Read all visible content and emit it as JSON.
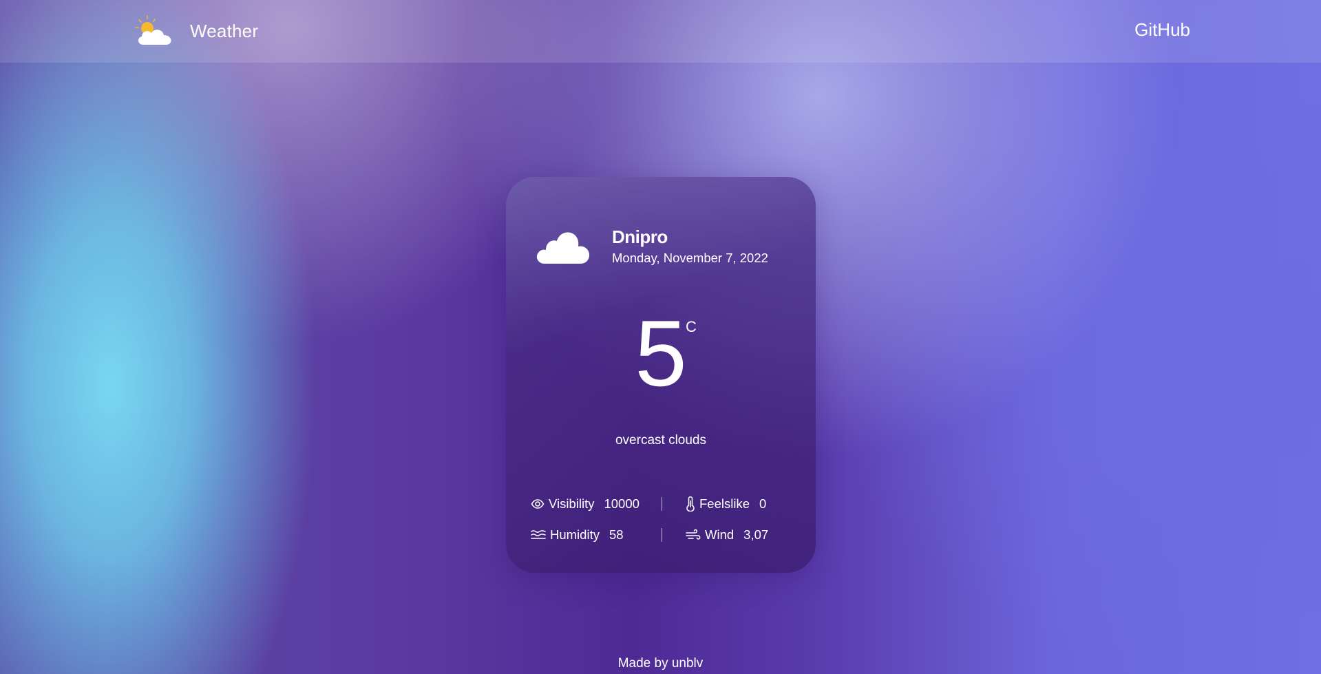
{
  "navbar": {
    "brand_text": "Weather",
    "brand_icon": "partly-cloudy-icon",
    "github_label": "GitHub"
  },
  "weather_card": {
    "city": "Dnipro",
    "date": "Monday, November 7, 2022",
    "temperature": "5",
    "unit": "C",
    "description": "overcast clouds",
    "condition_icon": "cloud-icon",
    "stats": {
      "visibility": {
        "label": "Visibility",
        "value": "10000",
        "icon": "eye-icon"
      },
      "feelslike": {
        "label": "Feelslike",
        "value": "0",
        "icon": "thermometer-icon"
      },
      "humidity": {
        "label": "Humidity",
        "value": "58",
        "icon": "humidity-icon"
      },
      "wind": {
        "label": "Wind",
        "value": "3,07",
        "icon": "wind-icon"
      }
    }
  },
  "footer": {
    "text": "Made by unblv"
  },
  "colors": {
    "accent_sun": "#f5b82e",
    "text": "#ffffff"
  }
}
